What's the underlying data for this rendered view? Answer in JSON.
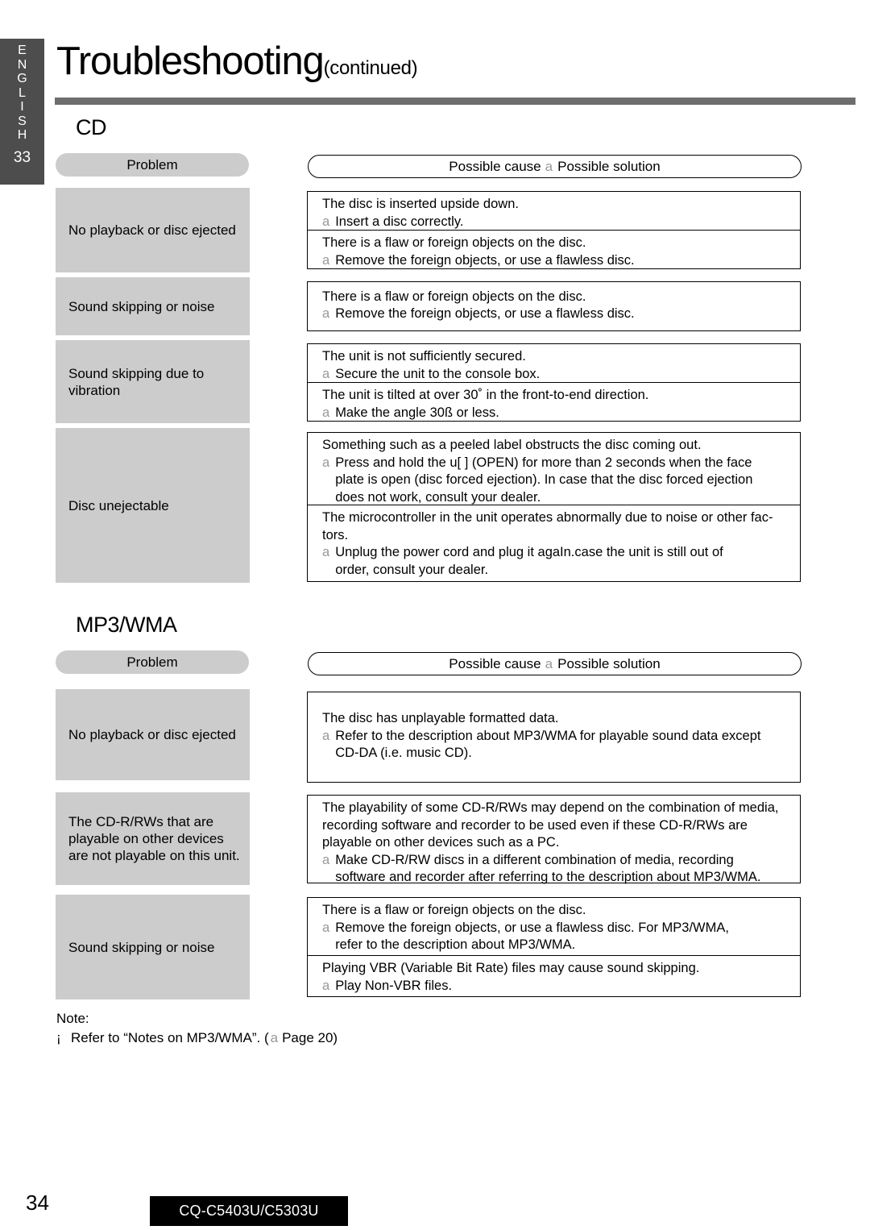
{
  "sidebar": {
    "language_letters": [
      "E",
      "N",
      "G",
      "L",
      "I",
      "S",
      "H"
    ],
    "tab_page_number": "33"
  },
  "header": {
    "title": "Troubleshooting",
    "title_suffix": "(continued)"
  },
  "sections": [
    {
      "heading": "CD",
      "columns": {
        "problem_label": "Problem",
        "solution_label_left": "Possible cause",
        "solution_arrow": "a",
        "solution_label_right": "Possible solution"
      },
      "rows": [
        {
          "problem": "No playback or disc ejected",
          "entries": [
            {
              "cause": "The disc is inserted upside down.",
              "arrow": "a",
              "fix": "Insert a disc correctly."
            },
            {
              "cause": "There is a flaw or foreign objects on the disc.",
              "arrow": "a",
              "fix": "Remove the foreign objects, or use a flawless disc."
            }
          ]
        },
        {
          "problem": "Sound skipping or noise",
          "entries": [
            {
              "cause": "There is a flaw or foreign objects on the disc.",
              "arrow": "a",
              "fix": "Remove the foreign objects, or use a flawless disc."
            }
          ]
        },
        {
          "problem": "Sound skipping due to vibration",
          "entries": [
            {
              "cause": "The unit is not sufficiently secured.",
              "arrow": "a",
              "fix": "Secure the unit to the console box."
            },
            {
              "cause": "The unit is tilted at over 30˚ in the front-to-end direction.",
              "arrow": "a",
              "fix": "Make the angle 30ß or less."
            }
          ]
        },
        {
          "problem": "Disc unejectable",
          "entries": [
            {
              "cause": "Something such as a peeled label obstructs the disc coming out.",
              "arrow": "a",
              "fix_lines": [
                "Press and hold the u[ ] (OPEN) for more than 2 seconds when the face",
                "plate is open (disc forced ejection). In case that the disc forced ejection",
                "does not work, consult your dealer."
              ]
            },
            {
              "cause_lines": [
                "The microcontroller in the unit operates abnormally due to noise or other fac-",
                "tors."
              ],
              "arrow": "a",
              "fix_lines": [
                "Unplug the power cord and plug it agaIn.case the unit is still out of",
                "order, consult your dealer."
              ]
            }
          ]
        }
      ]
    },
    {
      "heading": "MP3/WMA",
      "columns": {
        "problem_label": "Problem",
        "solution_label_left": "Possible cause",
        "solution_arrow": "a",
        "solution_label_right": "Possible solution"
      },
      "rows": [
        {
          "problem": "No playback or disc ejected",
          "entries": [
            {
              "cause": "The disc has unplayable formatted data.",
              "arrow": "a",
              "fix_lines": [
                "Refer to the description about MP3/WMA for playable sound data except",
                "CD-DA (i.e. music CD)."
              ]
            }
          ]
        },
        {
          "problem": "The CD-R/RWs that are playable on other devices are not playable on this unit.",
          "entries": [
            {
              "cause_lines": [
                "The playability of some CD-R/RWs may depend on the combination of media,",
                "recording software and recorder to be used even if these CD-R/RWs are",
                "playable on other devices such as a PC."
              ],
              "arrow": "a",
              "fix_lines": [
                "Make CD-R/RW discs in a different combination of media, recording",
                "software and recorder after referring to the description about MP3/WMA."
              ]
            }
          ]
        },
        {
          "problem": "Sound skipping or noise",
          "entries": [
            {
              "cause": "There is a flaw or foreign objects on the disc.",
              "arrow": "a",
              "fix_lines": [
                "Remove the foreign objects, or use a flawless disc. For MP3/WMA,",
                "refer to the description about MP3/WMA."
              ]
            },
            {
              "cause": "Playing VBR (Variable Bit Rate) files may cause sound skipping.",
              "arrow": "a",
              "fix": "Play Non-VBR files."
            }
          ]
        }
      ]
    }
  ],
  "note": {
    "label": "Note:",
    "bullet": "¡",
    "text_before": "Refer to “Notes on MP3/WMA”. (",
    "arrow": "a",
    "page_ref": "Page 20)"
  },
  "footer": {
    "page_number": "34",
    "model": "CQ-C5403U/C5303U"
  }
}
